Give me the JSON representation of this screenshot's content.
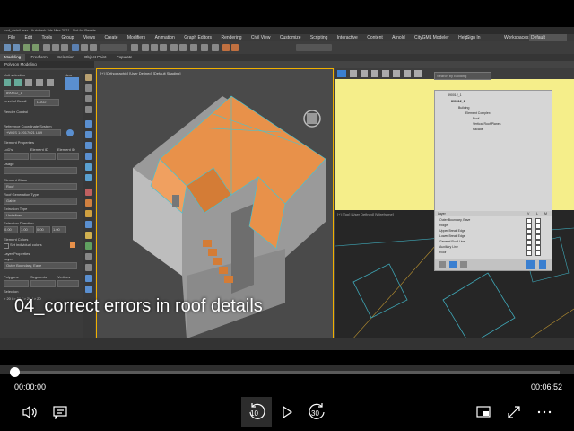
{
  "app": {
    "title": "roof_detail.max - Autodesk 3ds Max 2021 - Not for Resale",
    "menus": [
      "File",
      "Edit",
      "Tools",
      "Group",
      "Views",
      "Create",
      "Modifiers",
      "Animation",
      "Graph Editors",
      "Rendering",
      "Civil View",
      "Customize",
      "Scripting",
      "Interactive",
      "Content",
      "Arnold",
      "CityGML Modeler",
      "Help"
    ],
    "sign_in": "Sign In",
    "workspaces_label": "Workspaces:",
    "workspaces_value": "Default",
    "ribbon_tabs": [
      "Modeling",
      "Freeform",
      "Selection",
      "Object Paint",
      "Populate"
    ],
    "sub_ribbon": "Polygon Modeling",
    "search_placeholder": "Search by Building"
  },
  "left_panel": {
    "unit_selection": "Unit selection",
    "new_label": "New",
    "unit_id": "890012_1",
    "level_of_detail_label": "Level of Detail",
    "level_of_detail_value": "LOD2",
    "render_control": "Render Control",
    "reference_coordinate_system": "Reference Coordinate System",
    "crs_value": "+WGS 1:2017021 LB9",
    "element_properties": "Element Properties",
    "lod_fields": [
      "LoD's",
      "Element ID",
      "Element ID"
    ],
    "usage_label": "Usage",
    "element_class": "Element Class",
    "element_class_value": "Roof",
    "roof_generation_type": "Roof Generation Type",
    "roof_generation_value": "Gable",
    "extrusion_type": "Extrusion Type",
    "extrusion_type_value": "Undefined",
    "extrusion_direction": "Extrusion Direction",
    "extrusion_values": [
      "0.00",
      "1.00",
      "0.00",
      "1.00"
    ],
    "element_colors": "Element Colors",
    "individual_colors": "Set individual colors",
    "layer_properties": "Layer Properties",
    "layer_label": "Layer",
    "layer_value": "Outer Boundary, Eave",
    "bottom_fields": [
      "Polygons",
      "Segments",
      "Vertices"
    ],
    "selection_label": "Selection",
    "selection_values": "> 20 / > 20 / > 20 / > 20"
  },
  "viewport_persp": {
    "label": "[+] [Orthographic] [User Defined] [Default Shading]"
  },
  "viewport_bottom": {
    "label": "[+] [Top] [User Defined] [Wireframe]"
  },
  "scene_panel": {
    "tree": [
      "890012_1",
      "890012_1",
      "Building",
      "Element Complex",
      "Roof",
      "Vertical Roof Planes",
      "Facade"
    ],
    "layer_header": "Layer",
    "col_v": "V",
    "col_l": "L",
    "col_m": "M",
    "layers": [
      "Outer Boundary, Eave",
      "Ridge",
      "Upper Break Edge",
      "Lower Break Edge",
      "General Roof Line",
      "Auxiliary Line",
      "Roof"
    ]
  },
  "caption": "04_correct errors in roof details",
  "player": {
    "current_time": "00:00:00",
    "total_time": "00:06:52",
    "progress": 0.0,
    "rewind_label": "10",
    "forward_label": "30"
  },
  "colors": {
    "roof": "#e8914a",
    "viewport_highlight": "#f5ee8a",
    "accent": "#f0b000"
  }
}
